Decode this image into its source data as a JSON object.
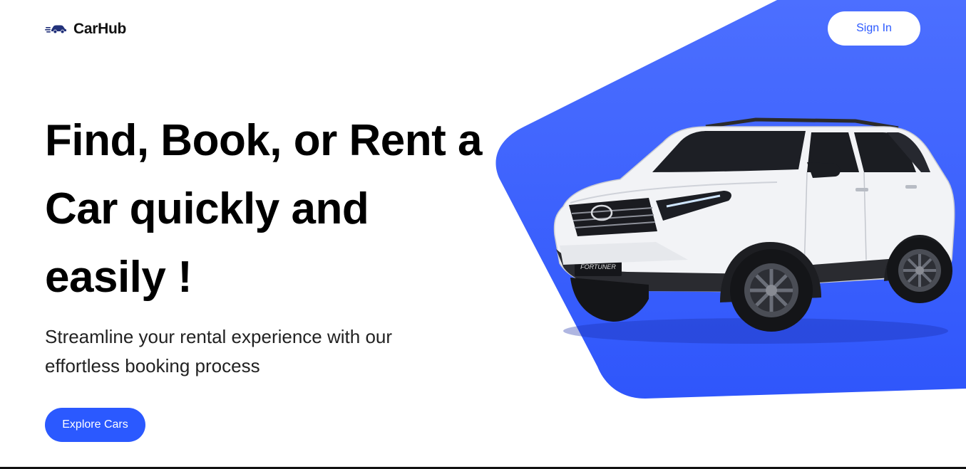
{
  "navbar": {
    "logo_text": "CarHub",
    "logo_icon": "car-speed-icon",
    "signin_label": "Sign In"
  },
  "hero": {
    "title": "Find, Book, or Rent a Car quickly and easily !",
    "subtitle": "Streamline your rental experience with our effortless booking process",
    "cta_label": "Explore Cars",
    "image": "white-suv-image"
  },
  "colors": {
    "accent": "#2b59ff",
    "hero_bg": "#3d63ff",
    "text": "#000000",
    "button_text": "#ffffff"
  }
}
